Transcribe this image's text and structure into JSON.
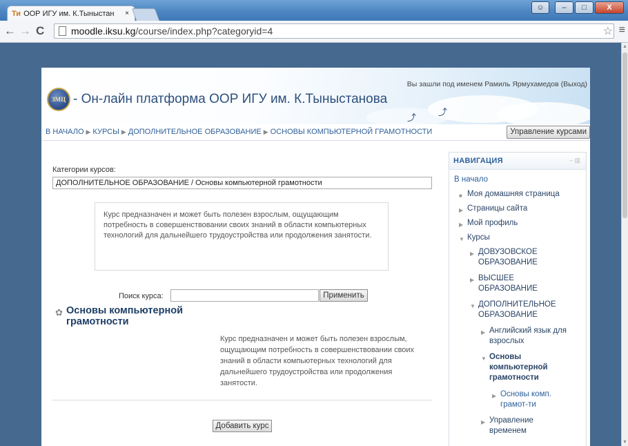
{
  "browser": {
    "tab_title": "ООР ИГУ им. К.Тыныстан",
    "tab_close": "×",
    "favicon_text": "Ти",
    "url_host": "moodle.iksu.kg",
    "url_path": "/course/index.php?categoryid=4",
    "nav_back": "←",
    "nav_forward": "→",
    "nav_reload": "C",
    "star": "☆",
    "menu": "≡",
    "win_min": "–",
    "win_max": "□",
    "win_close": "X"
  },
  "header": {
    "logo_text": "ЗМЦ",
    "site_title": "- Он-лайн платформа ООР ИГУ им. К.Тыныстанова",
    "login_info": "Вы зашли под именем Рамиль Ярмухамедов (Выход)"
  },
  "navbar": {
    "crumbs": [
      "В НАЧАЛО",
      "КУРСЫ",
      "ДОПОЛНИТЕЛЬНОЕ ОБРАЗОВАНИЕ",
      "ОСНОВЫ КОМПЬЮТЕРНОЙ ГРАМОТНОСТИ"
    ],
    "separator": "▶",
    "manage_button": "Управление курсами"
  },
  "main": {
    "category_label": "Категории курсов:",
    "category_value": "ДОПОЛНИТЕЛЬНОЕ ОБРАЗОВАНИЕ / Основы компьютерной грамотности",
    "category_description": "Курс предназначен и может быть полезен взрослым, ощущающим потребность в совершенствовании своих знаний в области компьютерных технологий для дальнейшего трудоустройства или продолжения занятости.",
    "search_label": "Поиск курса:",
    "search_value": "",
    "apply_button": "Применить",
    "course_name": "Основы компьютерной грамотности",
    "course_summary": "Курс предназначен и может быть полезен взрослым, ощущающим потребность в совершенствовании своих знаний в области компьютерных технологий для дальнейшего трудоустройства или продолжения занятости.",
    "add_course_button": "Добавить курс"
  },
  "navigation_block": {
    "title": "НАВИГАЦИЯ",
    "controls": "– ▥",
    "home": "В начало",
    "items": {
      "my_home": "Моя домашняя страница",
      "site_pages": "Страницы сайта",
      "my_profile": "Мой профиль",
      "courses": "Курсы",
      "preuniversity": "ДОВУЗОВСКОЕ ОБРАЗОВАНИЕ",
      "higher": "ВЫСШЕЕ ОБРАЗОВАНИЕ",
      "additional": "ДОПОЛНИТЕЛЬНОЕ ОБРАЗОВАНИЕ",
      "english": "Английский язык для взрослых",
      "basics": "Основы компьютерной грамотности",
      "basics_short": "Основы комп. грамот-ти",
      "time_mgmt": "Управление временем"
    }
  }
}
